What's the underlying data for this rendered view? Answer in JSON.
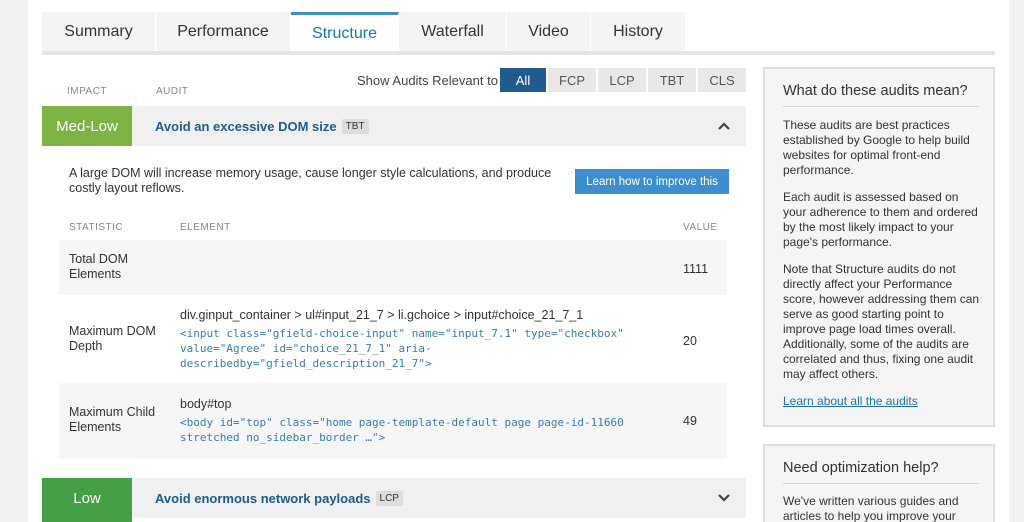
{
  "tabs": [
    "Summary",
    "Performance",
    "Structure",
    "Waterfall",
    "Video",
    "History"
  ],
  "active_tab": "Structure",
  "columns": {
    "impact": "IMPACT",
    "audit": "AUDIT"
  },
  "filter": {
    "label": "Show Audits Relevant to",
    "options": [
      "All",
      "FCP",
      "LCP",
      "TBT",
      "CLS"
    ],
    "active": "All"
  },
  "audits": [
    {
      "impact": "Med-Low",
      "impact_color": "#7cb342",
      "title": "Avoid an excessive DOM size",
      "metric": "TBT",
      "expanded": true,
      "description": "A large DOM will increase memory usage, cause longer style calculations, and produce costly layout reflows.",
      "learn_button": "Learn how to improve this",
      "table_headers": {
        "statistic": "STATISTIC",
        "element": "ELEMENT",
        "value": "VALUE"
      },
      "rows": [
        {
          "statistic": "Total DOM Elements",
          "selector": "",
          "code": "",
          "value": "1111"
        },
        {
          "statistic": "Maximum DOM Depth",
          "selector": "div.ginput_container > ul#input_21_7 > li.gchoice > input#choice_21_7_1",
          "code": "<input class=\"gfield-choice-input\" name=\"input_7.1\" type=\"checkbox\" value=\"Agree\" id=\"choice_21_7_1\" aria-describedby=\"gfield_description_21_7\">",
          "value": "20"
        },
        {
          "statistic": "Maximum Child Elements",
          "selector": "body#top",
          "code": "<body id=\"top\" class=\"home page-template-default page page-id-11660 stretched no_sidebar_border …\">",
          "value": "49"
        }
      ]
    },
    {
      "impact": "Low",
      "impact_color": "#43a047",
      "title": "Avoid enormous network payloads",
      "metric": "LCP",
      "expanded": false
    }
  ],
  "sidebar": {
    "box1": {
      "title": "What do these audits mean?",
      "p1": "These audits are best practices established by Google to help build websites for optimal front-end performance.",
      "p2": "Each audit is assessed based on your adherence to them and ordered by the most likely impact to your page's performance.",
      "p3": "Note that Structure audits do not directly affect your Performance score, however addressing them can serve as good starting point to improve page load times overall. Additionally, some of the audits are correlated and thus, fixing one audit may affect others.",
      "link": "Learn about all the audits"
    },
    "box2": {
      "title": "Need optimization help?",
      "p1": "We've written various guides and articles to help you improve your"
    }
  }
}
